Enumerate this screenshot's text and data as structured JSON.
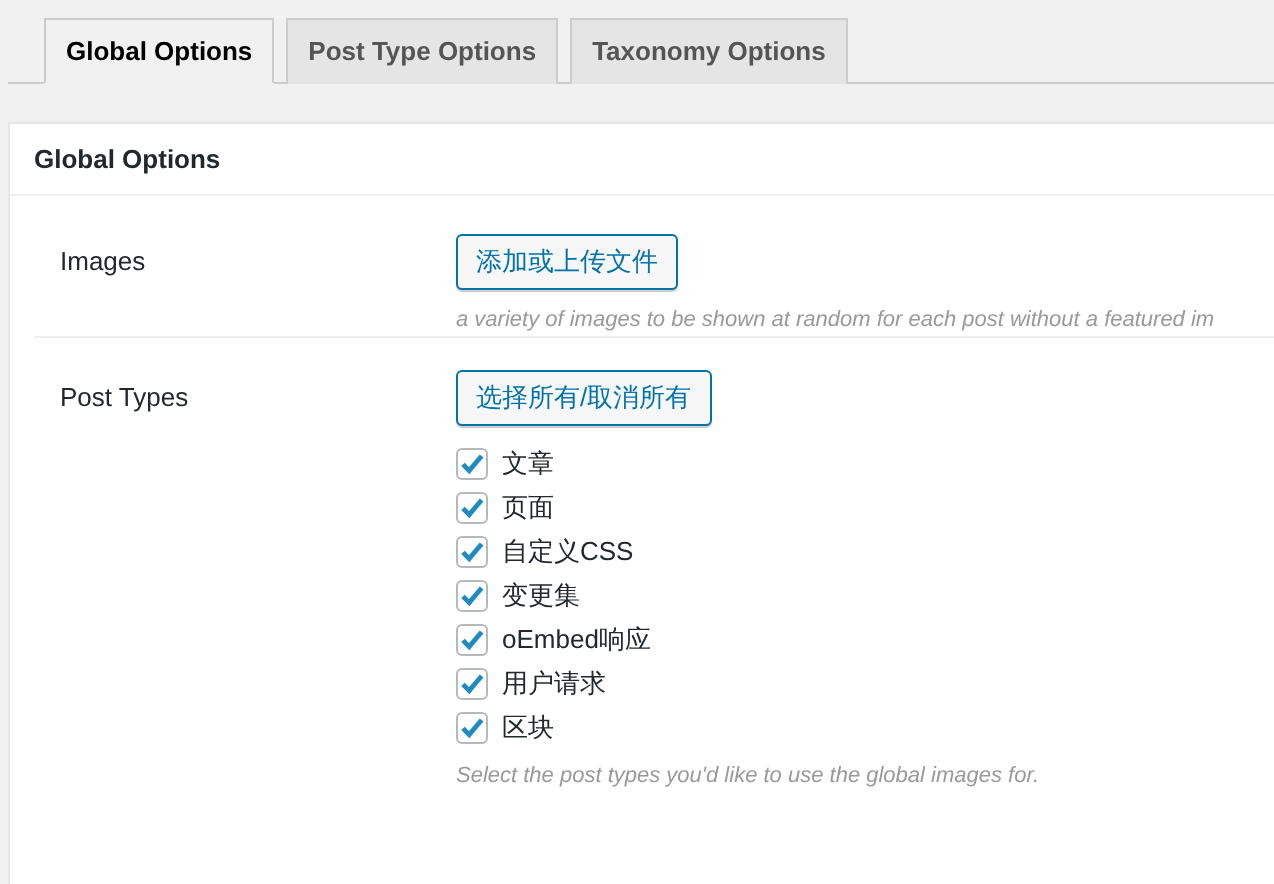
{
  "tabs": [
    {
      "label": "Global Options",
      "selected": true
    },
    {
      "label": "Post Type Options",
      "selected": false
    },
    {
      "label": "Taxonomy Options",
      "selected": false
    }
  ],
  "panel": {
    "title": "Global Options",
    "rows": [
      {
        "label": "Images",
        "button": "添加或上传文件",
        "description": "a variety of images to be shown at random for each post without a featured im"
      },
      {
        "label": "Post Types",
        "button": "选择所有/取消所有",
        "options": [
          {
            "label": "文章",
            "checked": true
          },
          {
            "label": "页面",
            "checked": true
          },
          {
            "label": "自定义CSS",
            "checked": true
          },
          {
            "label": "变更集",
            "checked": true
          },
          {
            "label": "oEmbed响应",
            "checked": true
          },
          {
            "label": "用户请求",
            "checked": true
          },
          {
            "label": "区块",
            "checked": true
          }
        ],
        "description": "Select the post types you'd like to use the global images for."
      }
    ]
  }
}
